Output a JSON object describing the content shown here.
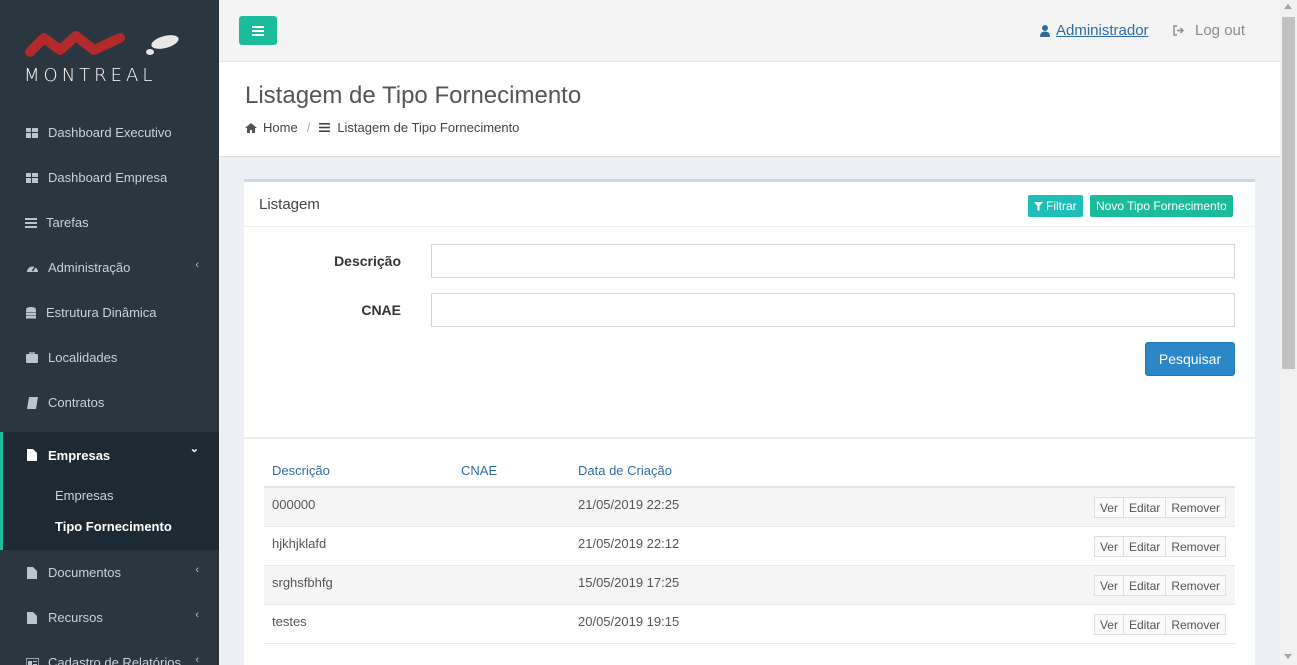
{
  "brand": {
    "logo_text": "MONTREAL",
    "accent": "#1abc9c",
    "sidebar_bg": "#2a3640"
  },
  "sidebar": {
    "items": [
      {
        "label": "Dashboard Executivo",
        "icon": "dashboard-icon"
      },
      {
        "label": "Dashboard Empresa",
        "icon": "dashboard-icon"
      },
      {
        "label": "Tarefas",
        "icon": "list-icon"
      },
      {
        "label": "Administração",
        "icon": "tachometer-icon",
        "chevron": "‹"
      },
      {
        "label": "Estrutura Dinâmica",
        "icon": "database-icon"
      },
      {
        "label": "Localidades",
        "icon": "briefcase-icon"
      },
      {
        "label": "Contratos",
        "icon": "book-icon"
      },
      {
        "label": "Empresas",
        "icon": "file-icon",
        "chevron": "⌄"
      },
      {
        "label": "Documentos",
        "icon": "file-icon",
        "chevron": "‹"
      },
      {
        "label": "Recursos",
        "icon": "file-icon",
        "chevron": "‹"
      },
      {
        "label": "Cadastro de Relatórios",
        "icon": "report-icon",
        "chevron": "‹"
      }
    ],
    "submenu": [
      {
        "label": "Empresas"
      },
      {
        "label": "Tipo Fornecimento"
      }
    ]
  },
  "header": {
    "user": "Administrador",
    "logout": "Log out"
  },
  "page": {
    "title": "Listagem de Tipo Fornecimento",
    "breadcrumb": {
      "home": "Home",
      "separator": "/",
      "current": "Listagem de Tipo Fornecimento"
    }
  },
  "box": {
    "title": "Listagem",
    "filter_label": "Filtrar",
    "new_label": "Novo Tipo Fornecimento",
    "form": {
      "descricao_label": "Descrição",
      "descricao_value": "",
      "cnae_label": "CNAE",
      "cnae_value": "",
      "search_label": "Pesquisar"
    },
    "table": {
      "columns": [
        "Descrição",
        "CNAE",
        "Data de Criação"
      ],
      "rows": [
        {
          "descricao": "000000",
          "cnae": "",
          "data": "21/05/2019 22:25"
        },
        {
          "descricao": "hjkhjklafd",
          "cnae": "",
          "data": "21/05/2019 22:12"
        },
        {
          "descricao": "srghsfbhfg",
          "cnae": "",
          "data": "15/05/2019 17:25"
        },
        {
          "descricao": "testes",
          "cnae": "",
          "data": "20/05/2019 19:15"
        }
      ],
      "actions": {
        "view": "Ver",
        "edit": "Editar",
        "remove": "Remover"
      }
    }
  }
}
